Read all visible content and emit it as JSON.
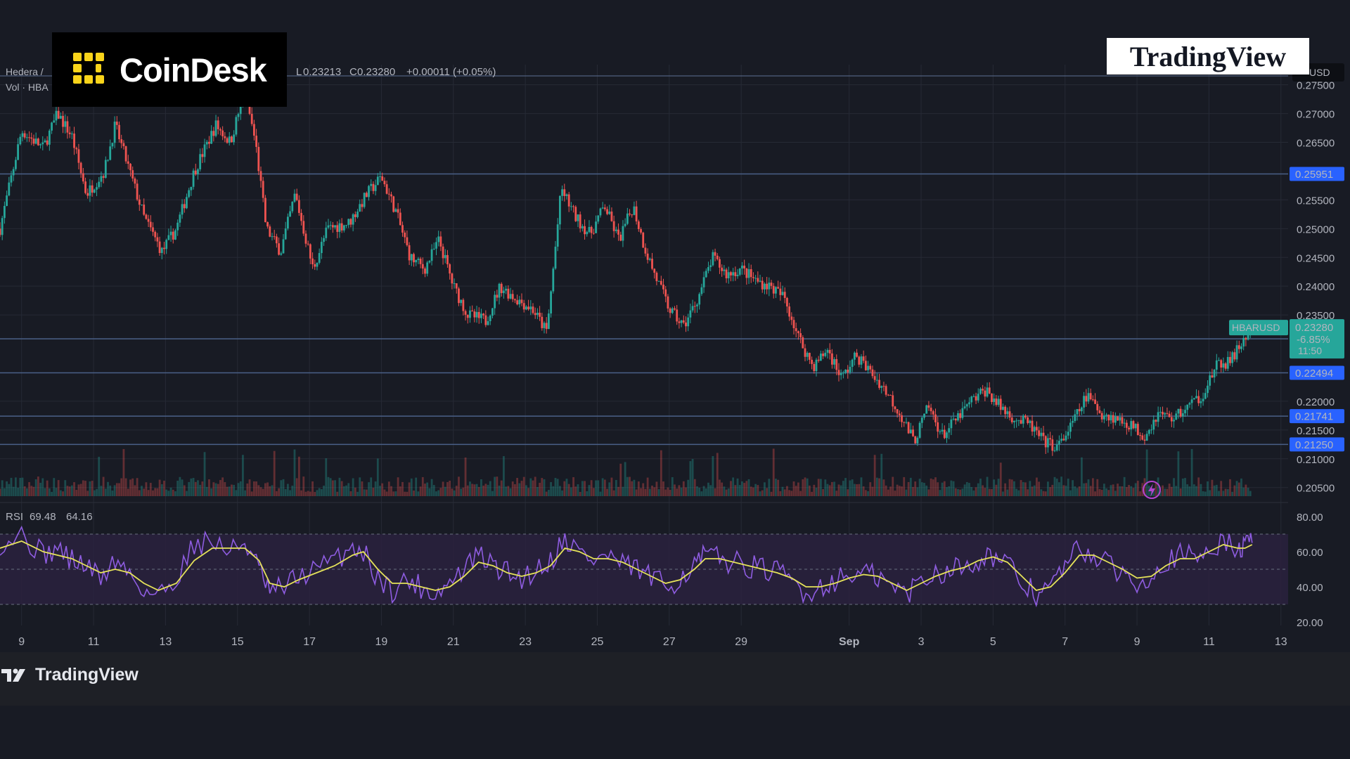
{
  "overlay": {
    "coindesk_brand": "CoinDesk",
    "tradingview_badge": "TradingView",
    "footer_brand": "TradingView"
  },
  "header": {
    "symbol": "Hedera /",
    "vol_label": "Vol · HBA",
    "low_prefix": "L",
    "low_value": "0.23213",
    "close_prefix": "C",
    "close_value": "0.23280",
    "change": "+0.00011 (+0.05%)",
    "currency": "USD"
  },
  "rsi": {
    "label": "RSI",
    "value1": "69.48",
    "value2": "64.16"
  },
  "colors": {
    "background": "#181b24",
    "grid": "#262a35",
    "up": "#26a69a",
    "down": "#ef5350",
    "level_line": "#4a6088",
    "level_tag": "#2962ff",
    "price_tag": "#26a69a",
    "rsi_line": "#8e5ce0",
    "rsi_ma": "#e6e35a",
    "rsi_band": "#2c2240",
    "alert": "#b345d0"
  },
  "chart_data": {
    "type": "candlestick",
    "symbol_tag": "HBARUSD",
    "last_price": "0.23280",
    "change_pct": "-6.85%",
    "countdown": "11:50",
    "price_axis": {
      "range": [
        0.2035,
        0.2785
      ],
      "ticks": [
        "0.27500",
        "0.27000",
        "0.26500",
        "0.25500",
        "0.25000",
        "0.24500",
        "0.24000",
        "0.23500",
        "0.22000",
        "0.21500",
        "0.21000",
        "0.20500"
      ]
    },
    "levels": [
      "0.25951",
      "0.23084",
      "0.22494",
      "0.21741",
      "0.21250"
    ],
    "x_axis": {
      "labels": [
        "9",
        "11",
        "13",
        "15",
        "17",
        "19",
        "21",
        "23",
        "25",
        "27",
        "29",
        "Sep",
        "3",
        "5",
        "7",
        "9",
        "11",
        "13"
      ],
      "day_range": [
        8.4,
        44.2
      ]
    },
    "price_path": [
      [
        8.4,
        0.25
      ],
      [
        9.0,
        0.267
      ],
      [
        9.6,
        0.264
      ],
      [
        10.0,
        0.27
      ],
      [
        10.4,
        0.266
      ],
      [
        10.8,
        0.256
      ],
      [
        11.3,
        0.26
      ],
      [
        11.6,
        0.268
      ],
      [
        12.0,
        0.26
      ],
      [
        12.4,
        0.252
      ],
      [
        12.9,
        0.246
      ],
      [
        13.3,
        0.25
      ],
      [
        13.8,
        0.26
      ],
      [
        14.4,
        0.268
      ],
      [
        14.8,
        0.265
      ],
      [
        15.2,
        0.274
      ],
      [
        15.5,
        0.265
      ],
      [
        15.8,
        0.25
      ],
      [
        16.2,
        0.246
      ],
      [
        16.6,
        0.256
      ],
      [
        17.1,
        0.243
      ],
      [
        17.5,
        0.25
      ],
      [
        18.1,
        0.251
      ],
      [
        18.6,
        0.256
      ],
      [
        19.0,
        0.259
      ],
      [
        19.4,
        0.253
      ],
      [
        19.8,
        0.245
      ],
      [
        20.2,
        0.243
      ],
      [
        20.6,
        0.248
      ],
      [
        21.0,
        0.24
      ],
      [
        21.4,
        0.235
      ],
      [
        21.9,
        0.234
      ],
      [
        22.3,
        0.24
      ],
      [
        22.7,
        0.238
      ],
      [
        23.2,
        0.236
      ],
      [
        23.6,
        0.232
      ],
      [
        24.0,
        0.257
      ],
      [
        24.4,
        0.252
      ],
      [
        24.8,
        0.249
      ],
      [
        25.2,
        0.254
      ],
      [
        25.6,
        0.248
      ],
      [
        26.0,
        0.254
      ],
      [
        26.3,
        0.247
      ],
      [
        26.6,
        0.242
      ],
      [
        27.0,
        0.236
      ],
      [
        27.4,
        0.233
      ],
      [
        27.8,
        0.238
      ],
      [
        28.2,
        0.245
      ],
      [
        28.6,
        0.242
      ],
      [
        29.0,
        0.243
      ],
      [
        29.4,
        0.241
      ],
      [
        29.8,
        0.24
      ],
      [
        30.2,
        0.238
      ],
      [
        30.6,
        0.231
      ],
      [
        31.0,
        0.226
      ],
      [
        31.4,
        0.229
      ],
      [
        31.8,
        0.224
      ],
      [
        32.2,
        0.228
      ],
      [
        32.6,
        0.225
      ],
      [
        33.0,
        0.222
      ],
      [
        33.4,
        0.218
      ],
      [
        33.8,
        0.213
      ],
      [
        34.2,
        0.219
      ],
      [
        34.6,
        0.214
      ],
      [
        35.0,
        0.217
      ],
      [
        35.4,
        0.22
      ],
      [
        35.8,
        0.222
      ],
      [
        36.2,
        0.219
      ],
      [
        36.6,
        0.217
      ],
      [
        37.0,
        0.216
      ],
      [
        37.4,
        0.213
      ],
      [
        37.8,
        0.212
      ],
      [
        38.2,
        0.216
      ],
      [
        38.6,
        0.221
      ],
      [
        39.0,
        0.218
      ],
      [
        39.4,
        0.217
      ],
      [
        39.8,
        0.216
      ],
      [
        40.2,
        0.214
      ],
      [
        40.6,
        0.218
      ],
      [
        41.0,
        0.217
      ],
      [
        41.4,
        0.219
      ],
      [
        41.8,
        0.221
      ],
      [
        42.2,
        0.226
      ],
      [
        42.6,
        0.227
      ],
      [
        42.9,
        0.23
      ],
      [
        43.2,
        0.2328
      ]
    ],
    "rsi_axis": {
      "range": [
        18,
        82
      ],
      "ticks": [
        "80.00",
        "60.00",
        "40.00",
        "20.00"
      ],
      "bands": [
        30,
        50,
        70
      ]
    },
    "rsi_path": [
      [
        8.4,
        65
      ],
      [
        9.0,
        70
      ],
      [
        9.6,
        58
      ],
      [
        10.0,
        62
      ],
      [
        10.4,
        55
      ],
      [
        10.8,
        52
      ],
      [
        11.2,
        45
      ],
      [
        11.6,
        55
      ],
      [
        12.0,
        48
      ],
      [
        12.4,
        38
      ],
      [
        12.8,
        35
      ],
      [
        13.3,
        45
      ],
      [
        13.8,
        65
      ],
      [
        14.3,
        66
      ],
      [
        14.8,
        60
      ],
      [
        15.2,
        66
      ],
      [
        15.6,
        50
      ],
      [
        15.9,
        36
      ],
      [
        16.3,
        40
      ],
      [
        16.7,
        46
      ],
      [
        17.2,
        50
      ],
      [
        17.7,
        55
      ],
      [
        18.2,
        63
      ],
      [
        18.5,
        60
      ],
      [
        18.9,
        45
      ],
      [
        19.3,
        38
      ],
      [
        19.7,
        44
      ],
      [
        20.1,
        40
      ],
      [
        20.5,
        36
      ],
      [
        20.9,
        42
      ],
      [
        21.3,
        50
      ],
      [
        21.7,
        58
      ],
      [
        22.1,
        52
      ],
      [
        22.5,
        48
      ],
      [
        22.9,
        45
      ],
      [
        23.3,
        50
      ],
      [
        23.7,
        55
      ],
      [
        24.1,
        68
      ],
      [
        24.5,
        60
      ],
      [
        24.9,
        55
      ],
      [
        25.3,
        58
      ],
      [
        25.7,
        52
      ],
      [
        26.1,
        50
      ],
      [
        26.5,
        45
      ],
      [
        26.9,
        40
      ],
      [
        27.3,
        45
      ],
      [
        27.7,
        52
      ],
      [
        28.0,
        58
      ],
      [
        28.4,
        56
      ],
      [
        28.8,
        54
      ],
      [
        29.2,
        52
      ],
      [
        29.6,
        50
      ],
      [
        30.0,
        48
      ],
      [
        30.4,
        44
      ],
      [
        30.8,
        36
      ],
      [
        31.2,
        40
      ],
      [
        31.6,
        44
      ],
      [
        32.0,
        46
      ],
      [
        32.4,
        48
      ],
      [
        32.8,
        45
      ],
      [
        33.2,
        40
      ],
      [
        33.6,
        36
      ],
      [
        34.0,
        44
      ],
      [
        34.4,
        48
      ],
      [
        34.8,
        50
      ],
      [
        35.2,
        52
      ],
      [
        35.6,
        56
      ],
      [
        36.0,
        58
      ],
      [
        36.4,
        52
      ],
      [
        36.8,
        42
      ],
      [
        37.2,
        36
      ],
      [
        37.6,
        40
      ],
      [
        38.0,
        52
      ],
      [
        38.4,
        62
      ],
      [
        38.8,
        58
      ],
      [
        39.2,
        52
      ],
      [
        39.6,
        48
      ],
      [
        40.0,
        42
      ],
      [
        40.4,
        48
      ],
      [
        40.8,
        55
      ],
      [
        41.2,
        58
      ],
      [
        41.6,
        56
      ],
      [
        42.0,
        62
      ],
      [
        42.4,
        66
      ],
      [
        42.8,
        60
      ],
      [
        43.0,
        64
      ],
      [
        43.2,
        65
      ]
    ],
    "rsi_ma_path": [
      [
        8.4,
        62
      ],
      [
        9.0,
        66
      ],
      [
        9.6,
        60
      ],
      [
        10.0,
        58
      ],
      [
        10.4,
        56
      ],
      [
        10.8,
        52
      ],
      [
        11.2,
        48
      ],
      [
        11.6,
        50
      ],
      [
        12.0,
        48
      ],
      [
        12.4,
        42
      ],
      [
        12.8,
        38
      ],
      [
        13.3,
        42
      ],
      [
        13.8,
        55
      ],
      [
        14.3,
        62
      ],
      [
        14.8,
        62
      ],
      [
        15.2,
        62
      ],
      [
        15.6,
        55
      ],
      [
        15.9,
        42
      ],
      [
        16.3,
        40
      ],
      [
        16.7,
        44
      ],
      [
        17.2,
        48
      ],
      [
        17.7,
        52
      ],
      [
        18.2,
        58
      ],
      [
        18.5,
        60
      ],
      [
        18.9,
        50
      ],
      [
        19.3,
        42
      ],
      [
        19.7,
        42
      ],
      [
        20.1,
        40
      ],
      [
        20.5,
        38
      ],
      [
        20.9,
        40
      ],
      [
        21.3,
        46
      ],
      [
        21.7,
        54
      ],
      [
        22.1,
        52
      ],
      [
        22.5,
        48
      ],
      [
        22.9,
        46
      ],
      [
        23.3,
        48
      ],
      [
        23.7,
        52
      ],
      [
        24.1,
        62
      ],
      [
        24.5,
        60
      ],
      [
        24.9,
        56
      ],
      [
        25.3,
        56
      ],
      [
        25.7,
        54
      ],
      [
        26.1,
        50
      ],
      [
        26.5,
        46
      ],
      [
        26.9,
        42
      ],
      [
        27.3,
        44
      ],
      [
        27.7,
        50
      ],
      [
        28.0,
        56
      ],
      [
        28.4,
        56
      ],
      [
        28.8,
        54
      ],
      [
        29.2,
        52
      ],
      [
        29.6,
        50
      ],
      [
        30.0,
        48
      ],
      [
        30.4,
        45
      ],
      [
        30.8,
        40
      ],
      [
        31.2,
        40
      ],
      [
        31.6,
        42
      ],
      [
        32.0,
        45
      ],
      [
        32.4,
        47
      ],
      [
        32.8,
        46
      ],
      [
        33.2,
        42
      ],
      [
        33.6,
        38
      ],
      [
        34.0,
        42
      ],
      [
        34.4,
        46
      ],
      [
        34.8,
        49
      ],
      [
        35.2,
        51
      ],
      [
        35.6,
        55
      ],
      [
        36.0,
        57
      ],
      [
        36.4,
        54
      ],
      [
        36.8,
        46
      ],
      [
        37.2,
        38
      ],
      [
        37.6,
        40
      ],
      [
        38.0,
        48
      ],
      [
        38.4,
        58
      ],
      [
        38.8,
        58
      ],
      [
        39.2,
        54
      ],
      [
        39.6,
        50
      ],
      [
        40.0,
        45
      ],
      [
        40.4,
        46
      ],
      [
        40.8,
        52
      ],
      [
        41.2,
        56
      ],
      [
        41.6,
        56
      ],
      [
        42.0,
        60
      ],
      [
        42.4,
        64
      ],
      [
        42.8,
        62
      ],
      [
        43.0,
        62
      ],
      [
        43.2,
        64
      ]
    ]
  }
}
